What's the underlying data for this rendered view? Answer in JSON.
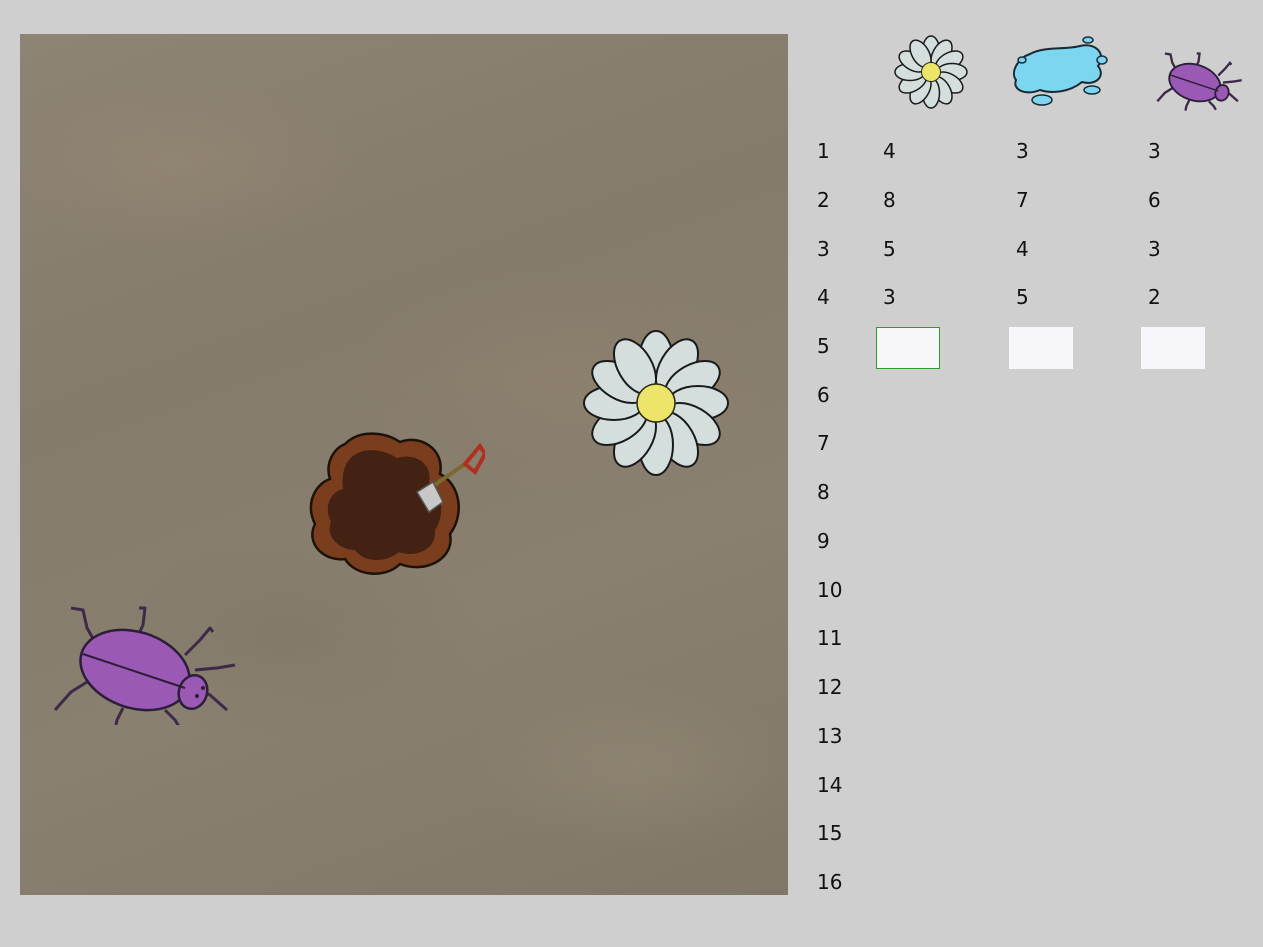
{
  "columns": [
    {
      "icon": "flower-icon"
    },
    {
      "icon": "puddle-icon"
    },
    {
      "icon": "beetle-icon"
    }
  ],
  "rows": [
    {
      "n": "1",
      "values": [
        "4",
        "3",
        "3"
      ]
    },
    {
      "n": "2",
      "values": [
        "8",
        "7",
        "6"
      ]
    },
    {
      "n": "3",
      "values": [
        "5",
        "4",
        "3"
      ]
    },
    {
      "n": "4",
      "values": [
        "3",
        "5",
        "2"
      ]
    },
    {
      "n": "5",
      "values": [
        "",
        "",
        ""
      ]
    },
    {
      "n": "6"
    },
    {
      "n": "7"
    },
    {
      "n": "8"
    },
    {
      "n": "9"
    },
    {
      "n": "10"
    },
    {
      "n": "11"
    },
    {
      "n": "12"
    },
    {
      "n": "13"
    },
    {
      "n": "14"
    },
    {
      "n": "15"
    },
    {
      "n": "16"
    }
  ],
  "field": {
    "objects": [
      "beetle-icon",
      "dirt-patch-with-shovel-icon",
      "flower-icon"
    ]
  },
  "colors": {
    "active_input_border": "#2aa02a",
    "beetle": "#9b59b6",
    "puddle": "#7dd6ef",
    "flower_petal": "#d4dedd",
    "flower_center": "#ece56a"
  }
}
